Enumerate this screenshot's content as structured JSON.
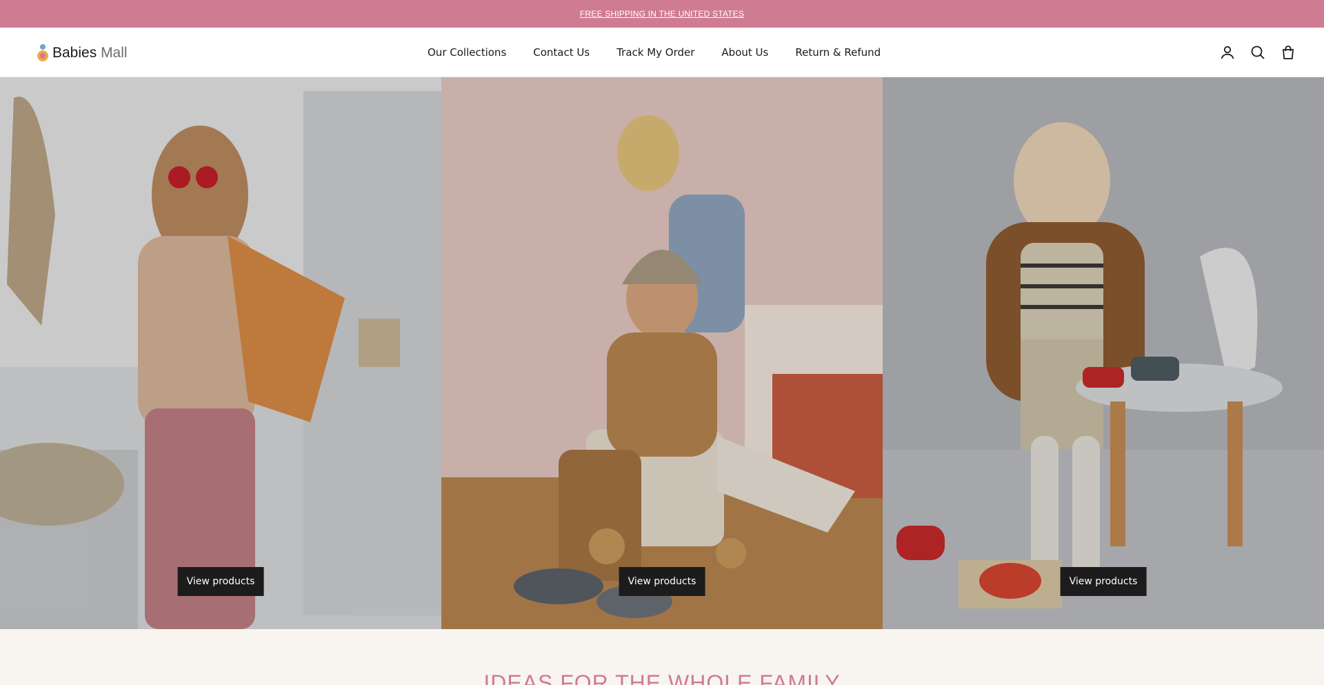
{
  "announcement": {
    "text": "FREE SHIPPING IN THE UNITED STATES"
  },
  "header": {
    "logo": {
      "primary": "Babies",
      "secondary": "Mall"
    },
    "nav": [
      {
        "label": "Our Collections"
      },
      {
        "label": "Contact Us"
      },
      {
        "label": "Track My Order"
      },
      {
        "label": "About Us"
      },
      {
        "label": "Return & Refund"
      }
    ],
    "icons": [
      "account-icon",
      "search-icon",
      "cart-icon"
    ]
  },
  "hero": {
    "panels": [
      {
        "button_label": "View products"
      },
      {
        "button_label": "View products"
      },
      {
        "button_label": "View products"
      }
    ]
  },
  "section": {
    "heading": "IDEAS FOR THE WHOLE FAMILY"
  },
  "colors": {
    "accent": "#cf7b92",
    "button": "#1c1c1c",
    "background": "#f8f5f0"
  }
}
